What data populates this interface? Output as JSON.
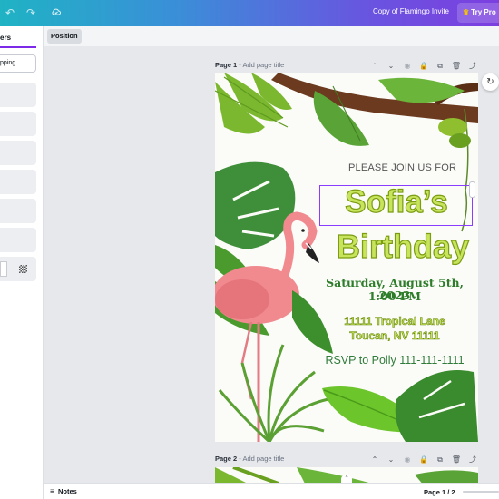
{
  "topbar": {
    "undo_icon": "undo-icon",
    "redo_icon": "redo-icon",
    "cloud_icon": "cloud-saved-icon",
    "doc_title": "Copy of Flamingo Invite",
    "try_pro_label": "Try Pro",
    "gradient_colors": [
      "#1fb3c4",
      "#3a8fd8",
      "#6a53e0",
      "#7c3fe0"
    ]
  },
  "left_panel": {
    "tab_label": "ers",
    "button_label": "pping"
  },
  "subtoolbar": {
    "position_label": "Position"
  },
  "pages": [
    {
      "label": "Page 1",
      "separator": " - ",
      "title_placeholder": "Add page title"
    },
    {
      "label": "Page 2",
      "separator": " - ",
      "title_placeholder": "Add page title"
    }
  ],
  "invite": {
    "join_text": "PLEASE JOIN US FOR",
    "name": "Sofia’s",
    "event": "Birthday",
    "date_line": "Saturday, August 5th, 2023",
    "time_line": "1:00 PM",
    "address_line1": "11111 Tropical Lane",
    "address_line2": "Toucan, NV 11111",
    "rsvp_line": "RSVP to Polly 111-111-1111",
    "colors": {
      "accent_text": "#c8e35c",
      "accent_stroke": "#7a9d12",
      "green_text": "#2e7d2a",
      "selection": "#8b3dff"
    }
  },
  "footer": {
    "notes_label": "Notes",
    "page_indicator": "Page 1 / 2"
  }
}
